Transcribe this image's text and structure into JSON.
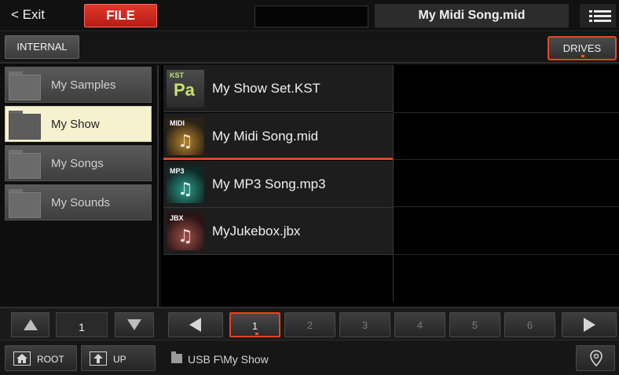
{
  "topbar": {
    "exit_label": "< Exit",
    "file_label": "FILE",
    "song_title": "My Midi Song.mid",
    "menu_icon": "hamburger-menu-icon"
  },
  "secondbar": {
    "internal_label": "INTERNAL",
    "drives_label": "DRIVES"
  },
  "folders": [
    {
      "label": "My Samples",
      "selected": false,
      "icon": "folder-icon"
    },
    {
      "label": "My Show",
      "selected": true,
      "icon": "folder-icon"
    },
    {
      "label": "My Songs",
      "selected": false,
      "icon": "folder-icon"
    },
    {
      "label": "My Sounds",
      "selected": false,
      "icon": "folder-icon"
    }
  ],
  "files": [
    {
      "name": "My Show Set.KST",
      "type_tag": "KST",
      "icon": "korg-pa-set-icon",
      "selected": false
    },
    {
      "name": "My Midi Song.mid",
      "type_tag": "MIDI",
      "icon": "midi-song-icon",
      "selected": true
    },
    {
      "name": "My MP3 Song.mp3",
      "type_tag": "MP3",
      "icon": "mp3-song-icon",
      "selected": false
    },
    {
      "name": "MyJukebox.jbx",
      "type_tag": "JBX",
      "icon": "jukebox-icon",
      "selected": false
    }
  ],
  "folder_pager": {
    "page": "1"
  },
  "file_pager": {
    "pages": [
      "1",
      "2",
      "3",
      "4",
      "5",
      "6"
    ],
    "active_page": "1"
  },
  "bottom": {
    "root_label": "ROOT",
    "up_label": "UP",
    "path": "USB F\\My Show"
  },
  "colors": {
    "accent": "#e8421e",
    "file_button": "#c8241a",
    "selected_folder": "#f6f2cf"
  }
}
